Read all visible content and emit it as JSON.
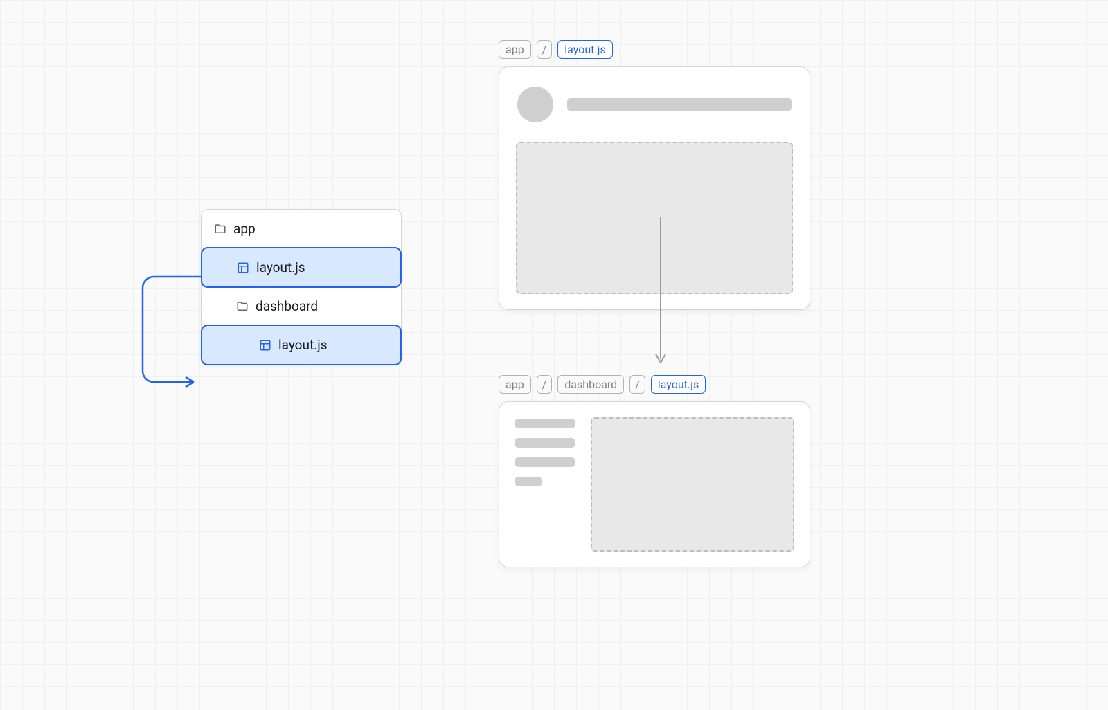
{
  "tree": {
    "root": "app",
    "root_layout": "layout.js",
    "child_dir": "dashboard",
    "child_layout": "layout.js"
  },
  "crumbsTop": {
    "seg1": "app",
    "sep": "/",
    "file": "layout.js"
  },
  "crumbsBottom": {
    "seg1": "app",
    "sep1": "/",
    "seg2": "dashboard",
    "sep2": "/",
    "file": "layout.js"
  },
  "colors": {
    "highlight_border": "#2563eb",
    "highlight_fill": "#d7e8ff",
    "placeholder": "#cfcfcf",
    "dashed_border": "#bdbdbd"
  }
}
